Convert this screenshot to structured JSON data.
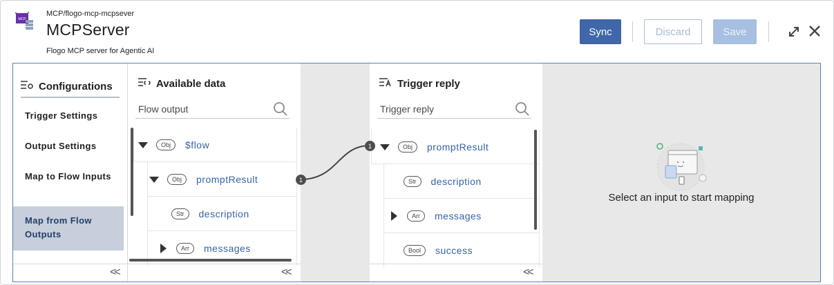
{
  "header": {
    "breadcrumb": "MCP/flogo-mcp-mcpsever",
    "title": "MCPServer",
    "subtitle": "Flogo MCP server for Agentic AI",
    "app_icon_text": "MCP",
    "sync_label": "Sync",
    "discard_label": "Discard",
    "save_label": "Save"
  },
  "config": {
    "title": "Configurations",
    "items": [
      {
        "label": "Trigger Settings"
      },
      {
        "label": "Output Settings"
      },
      {
        "label": "Map to Flow Inputs"
      },
      {
        "label": "Map from Flow Outputs",
        "active": true
      }
    ],
    "collapse_glyph": "<<"
  },
  "available": {
    "title": "Available data",
    "search_placeholder": "Flow output",
    "tree": [
      {
        "type": "Obj",
        "label": "$flow"
      },
      {
        "type": "Obj",
        "label": "promptResult",
        "mapping_badge": "1"
      },
      {
        "type": "Str",
        "label": "description"
      },
      {
        "type": "Arr",
        "label": "messages"
      }
    ]
  },
  "reply": {
    "title": "Trigger reply",
    "search_placeholder": "Trigger reply",
    "tree": [
      {
        "type": "Obj",
        "label": "promptResult",
        "mapping_badge": "1"
      },
      {
        "type": "Str",
        "label": "description"
      },
      {
        "type": "Arr",
        "label": "messages"
      },
      {
        "type": "Bool",
        "label": "success"
      }
    ]
  },
  "empty_state": {
    "message": "Select an input to start mapping"
  },
  "colors": {
    "primary": "#3f67a9",
    "link": "#3563a8",
    "active_nav": "#c6cfdb"
  }
}
